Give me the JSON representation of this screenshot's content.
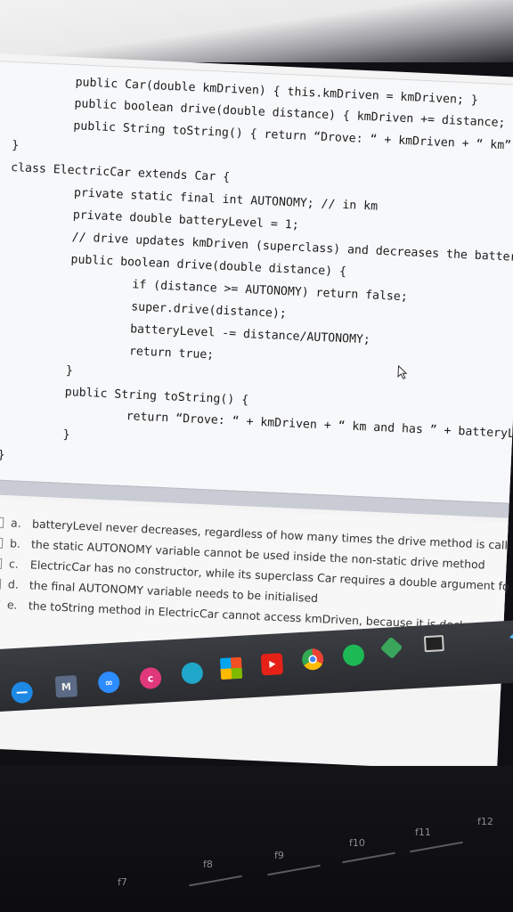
{
  "code": {
    "lines": [
      "public Car(double kmDriven) { this.kmDriven = kmDriven; }",
      "public boolean drive(double distance) { kmDriven += distance; r",
      "public String toString() { return “Drove: “ + kmDriven + “ km”;",
      "}",
      "class ElectricCar extends Car {",
      "private static final int AUTONOMY; // in km",
      "private double batteryLevel = 1;",
      "// drive updates kmDriven (superclass) and decreases the batter",
      "public boolean drive(double distance) {",
      "if (distance >= AUTONOMY) return false;",
      "super.drive(distance);",
      "batteryLevel -= distance/AUTONOMY;",
      "return true;",
      "}",
      "public String toString() {",
      "return “Drove: “ + kmDriven + “ km and has ” + batteryL",
      "}",
      "}"
    ]
  },
  "options": [
    {
      "letter": "a.",
      "text": "batteryLevel never decreases, regardless of how many times the drive method is call"
    },
    {
      "letter": "b.",
      "text": "the static AUTONOMY variable cannot be used inside the non-static drive method"
    },
    {
      "letter": "c.",
      "text": "ElectricCar has no constructor, while its superclass Car requires a double argument fo"
    },
    {
      "letter": "d.",
      "text": "the final AUTONOMY variable needs to be initialised"
    },
    {
      "letter": "e.",
      "text": "the toString method in ElectricCar cannot access kmDriven, because it is declared as"
    }
  ],
  "taskbar": {
    "icons": [
      "windows-icon",
      "mail-icon",
      "infinity-icon",
      "circle-c-icon",
      "edge-icon",
      "office-icon",
      "youtube-icon",
      "chrome-icon",
      "spotify-icon",
      "gem-icon",
      "screen-icon",
      "umbrella-icon"
    ],
    "mail_glyph": "M",
    "infinity_glyph": "∞",
    "c_glyph": "c"
  },
  "keyboard": {
    "keys": [
      "f7",
      "f8",
      "f9",
      "f10",
      "f11",
      "f12"
    ]
  }
}
